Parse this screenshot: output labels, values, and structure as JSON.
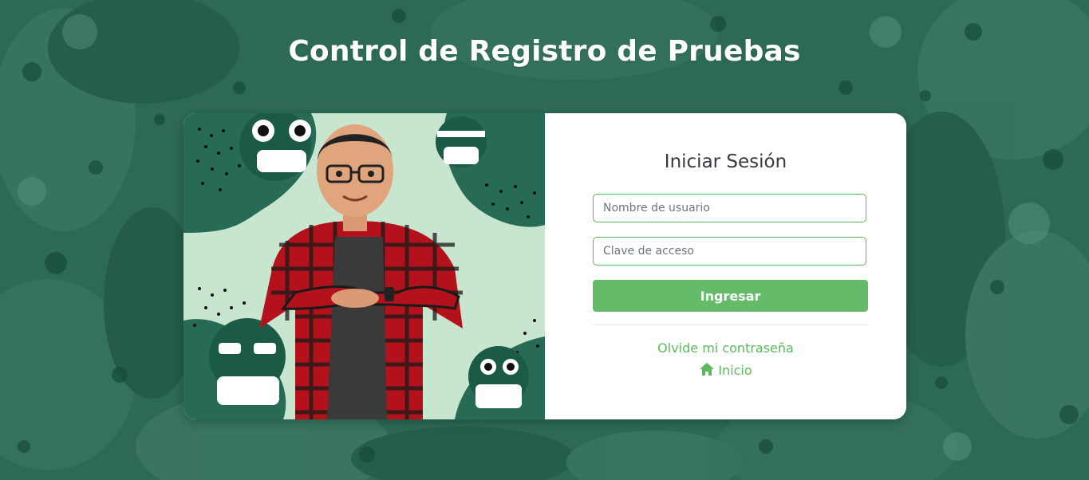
{
  "page": {
    "title": "Control de Registro de Pruebas"
  },
  "login": {
    "heading": "Iniciar Sesión",
    "username_placeholder": "Nombre de usuario",
    "password_placeholder": "Clave de acceso",
    "submit_label": "Ingresar",
    "forgot_password_label": "Olvide mi contraseña",
    "home_label": "Inicio",
    "home_icon": "home-icon"
  },
  "colors": {
    "background": "#2f6b58",
    "accent": "#66bb6a",
    "link": "#5cb85c",
    "illustration_bg": "#c8e6cf"
  }
}
